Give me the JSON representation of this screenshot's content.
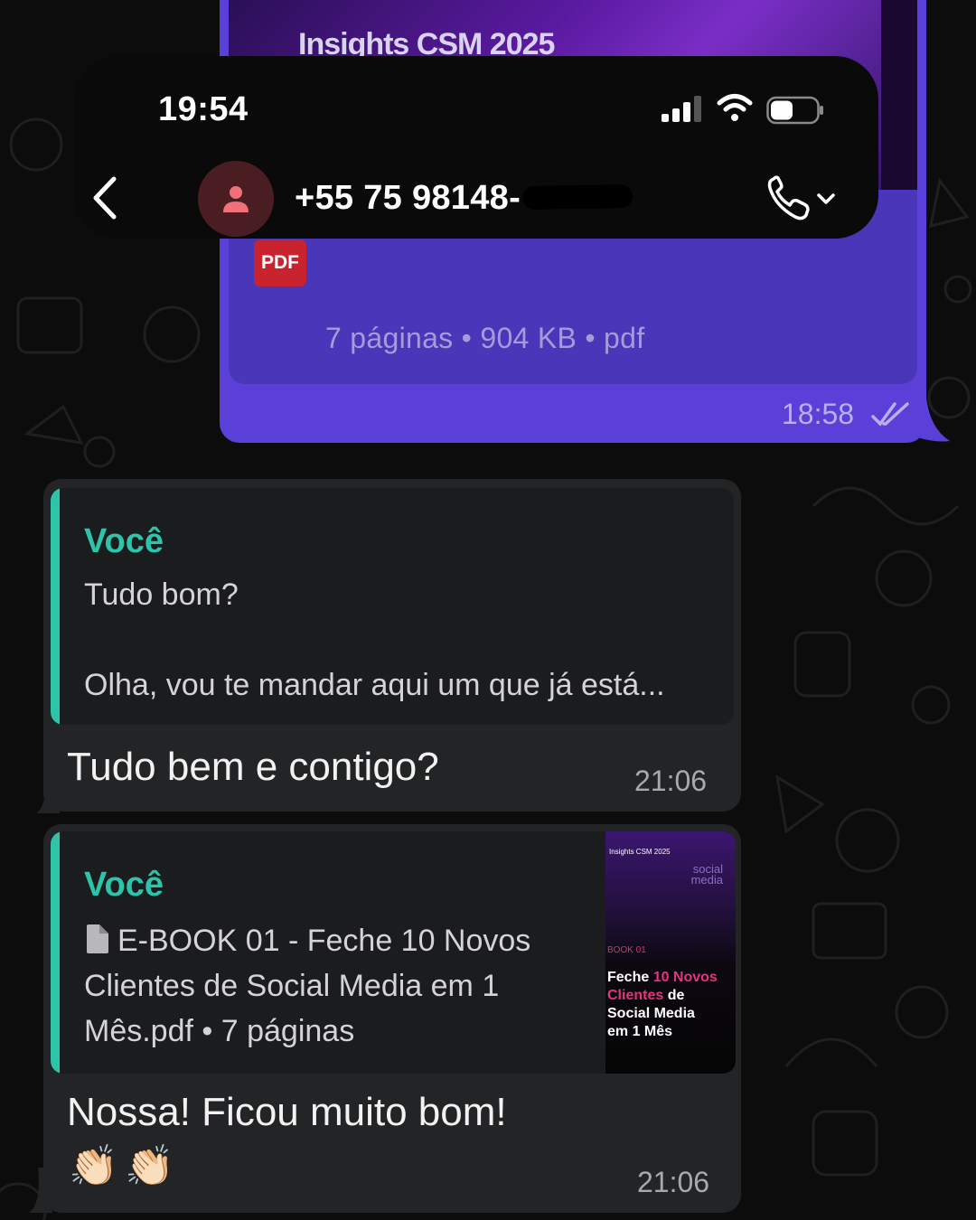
{
  "status_bar": {
    "time": "19:54"
  },
  "header": {
    "contact_name": "+55 75 98148-",
    "back_icon": "chevron-left-icon",
    "call_icon": "phone-icon"
  },
  "outgoing_document": {
    "preview_title": "Insights CSM 2025",
    "badge": "PDF",
    "meta": "7 páginas • 904 KB • pdf",
    "time": "18:58"
  },
  "messages": [
    {
      "quote_author": "Você",
      "quote_line1": "Tudo bom?",
      "quote_line2": "Olha, vou te mandar aqui um que já está...",
      "text": "Tudo bem e contigo?",
      "time": "21:06"
    },
    {
      "quote_author": "Você",
      "quote_line1": "E-BOOK 01 - Feche 10 Novos",
      "quote_line2": "Clientes de Social Media em 1",
      "quote_line3": "Mês.pdf • 7 páginas",
      "thumb": {
        "top_label": "Insights CSM 2025",
        "sub": "social media",
        "book": "BOOK 01",
        "title_a": "Feche ",
        "title_b": "10 Novos",
        "title_c": "Clientes",
        "title_d": " de",
        "title_e": "Social Media",
        "title_f": "em 1 Mês"
      },
      "text": "Nossa! Ficou muito bom!",
      "emoji": "👏🏻",
      "time": "21:06"
    }
  ],
  "colors": {
    "accent": "#2ec4a9",
    "outgoing": "#5b3fd9",
    "incoming": "#232425",
    "background": "#0c0c0d"
  }
}
